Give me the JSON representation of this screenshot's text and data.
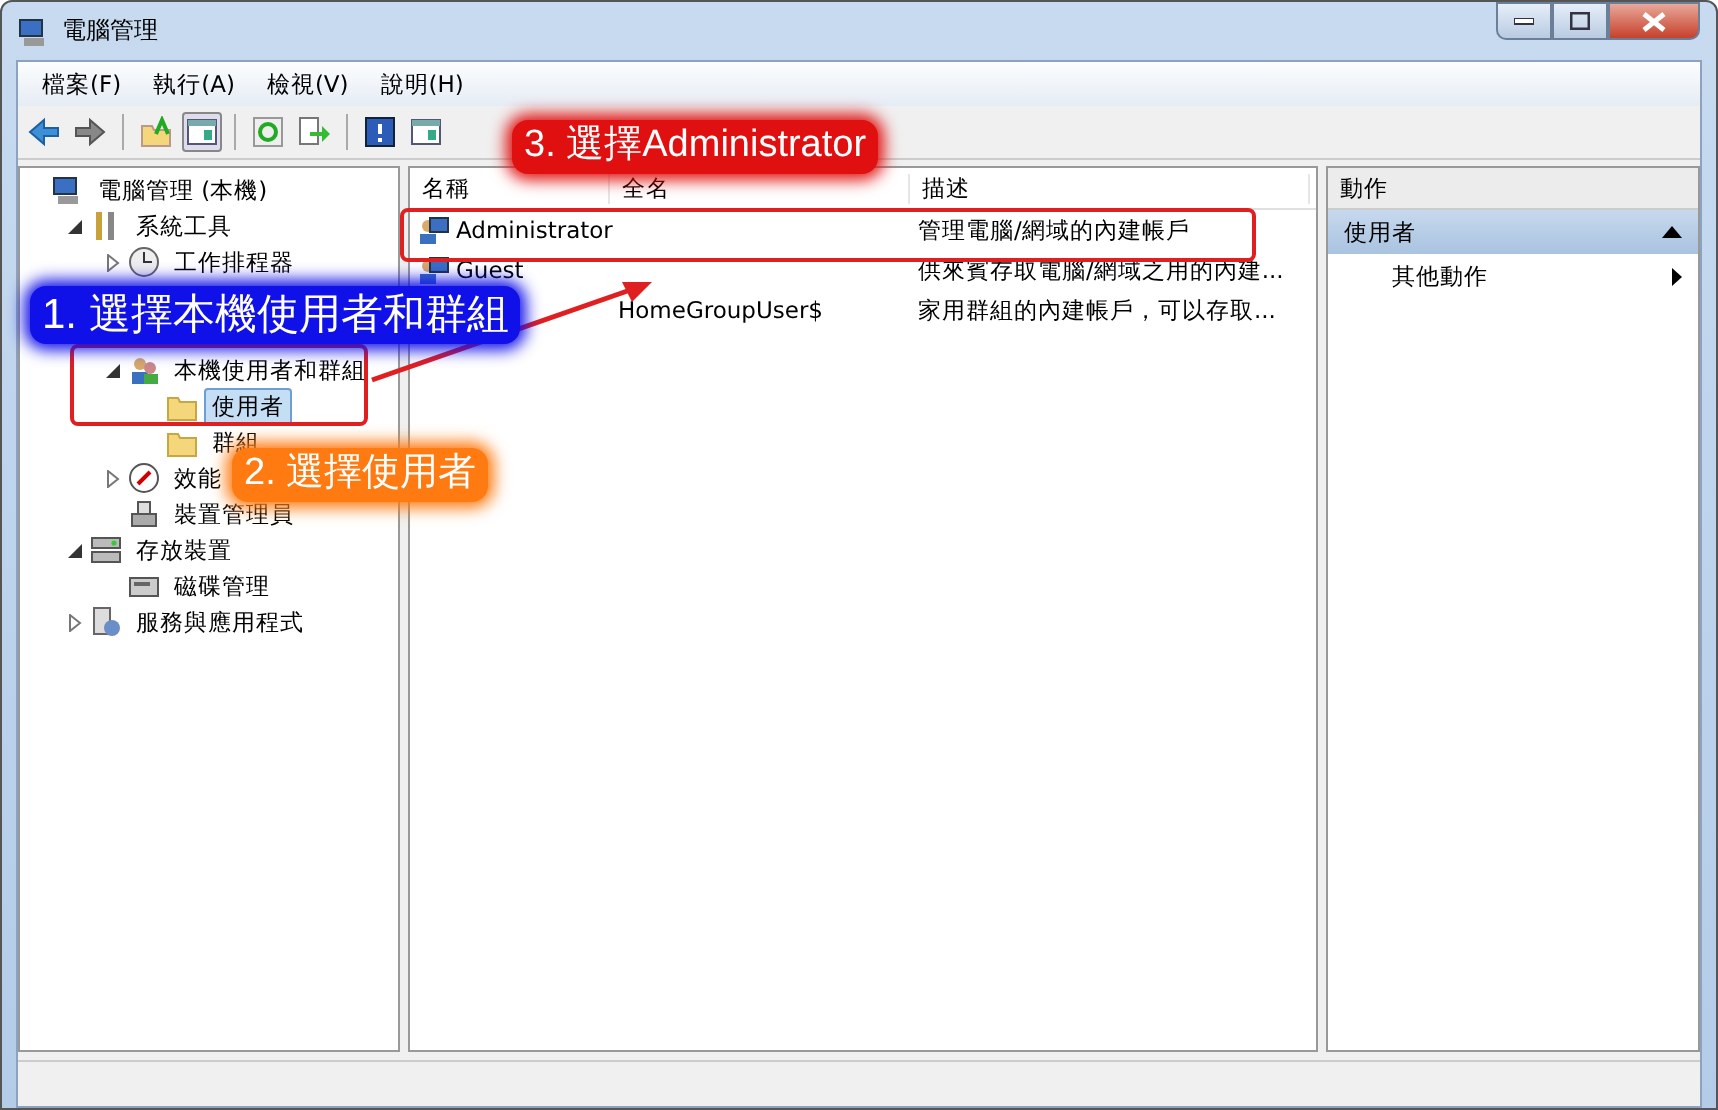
{
  "window": {
    "title": "電腦管理"
  },
  "menu": [
    "檔案(F)",
    "執行(A)",
    "檢視(V)",
    "說明(H)"
  ],
  "toolbar": [
    {
      "kind": "back"
    },
    {
      "kind": "forward"
    },
    {
      "kind": "sep"
    },
    {
      "kind": "up"
    },
    {
      "kind": "pane",
      "selected": true
    },
    {
      "kind": "sep"
    },
    {
      "kind": "refresh"
    },
    {
      "kind": "export"
    },
    {
      "kind": "sep"
    },
    {
      "kind": "help"
    },
    {
      "kind": "pane",
      "selected": false
    }
  ],
  "tree": [
    {
      "label": "電腦管理 (本機)",
      "kind": "computer",
      "selected": false,
      "children": [
        {
          "label": "系統工具",
          "kind": "tools",
          "expanded": true,
          "selected": false,
          "children": [
            {
              "label": "工作排程器",
              "kind": "clock",
              "expanded": false,
              "selected": false
            },
            {
              "kind": "blank"
            },
            {
              "kind": "blank"
            },
            {
              "label": "本機使用者和群組",
              "kind": "users",
              "expanded": true,
              "selected": false,
              "children": [
                {
                  "label": "使用者",
                  "kind": "folder",
                  "selected": true
                },
                {
                  "label": "群組",
                  "kind": "folder",
                  "selected": false
                }
              ]
            },
            {
              "label": "效能",
              "kind": "gauge",
              "expanded": false,
              "selected": false
            },
            {
              "label": "裝置管理員",
              "kind": "device",
              "selected": false
            }
          ]
        },
        {
          "label": "存放裝置",
          "kind": "storage",
          "expanded": true,
          "selected": false,
          "children": [
            {
              "label": "磁碟管理",
              "kind": "disk",
              "selected": false
            }
          ]
        },
        {
          "label": "服務與應用程式",
          "kind": "services",
          "expanded": false,
          "selected": false
        }
      ]
    }
  ],
  "table": {
    "columns": [
      "名稱",
      "全名",
      "描述"
    ],
    "rows": [
      {
        "name": "Administrator",
        "description": "管理電腦/網域的內建帳戶"
      },
      {
        "name": "Guest",
        "description": "供來賓存取電腦/網域之用的內建..."
      },
      {
        "full_name": "HomeGroupUser$",
        "description": "家用群組的內建帳戶，可以存取..."
      }
    ]
  },
  "actions": {
    "title": "動作",
    "section": "使用者",
    "items": [
      "其他動作"
    ]
  },
  "annotations": [
    {
      "kind": "callout",
      "text": "3. 選擇Administrator",
      "color": "#e01010"
    },
    {
      "kind": "callout",
      "text": "1. 選擇本機使用者和群組",
      "color": "#1010e8"
    },
    {
      "kind": "callout",
      "text": "2. 選擇使用者",
      "color": "#ff7a10"
    }
  ]
}
